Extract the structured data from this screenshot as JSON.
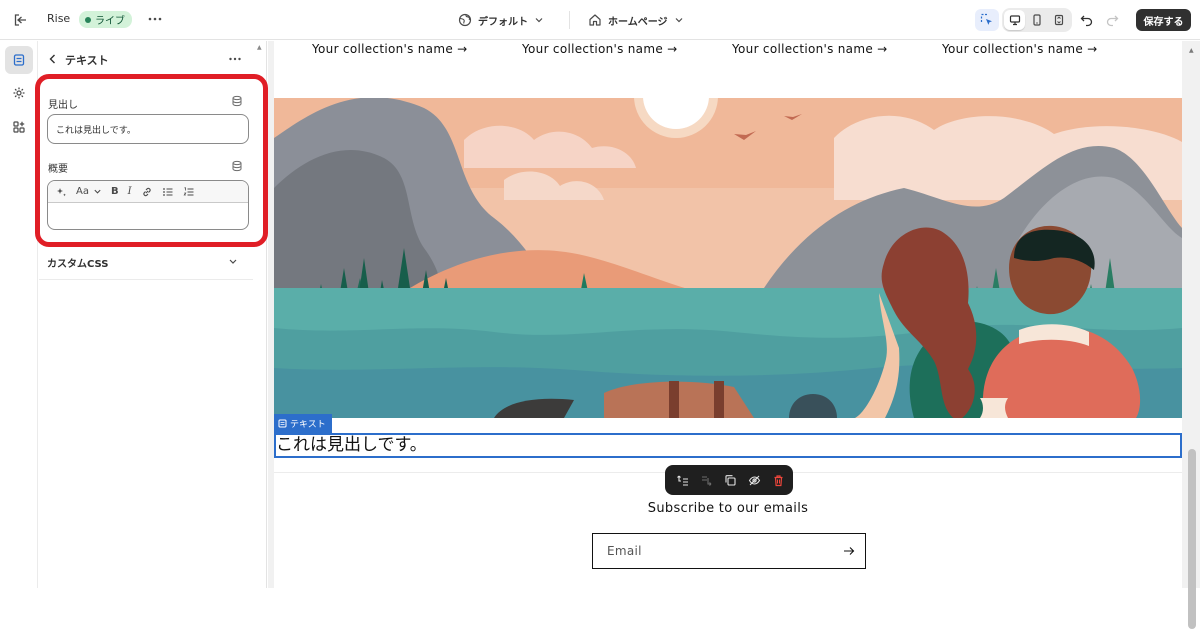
{
  "topbar": {
    "store_name": "Rise",
    "status_label": "ライブ",
    "theme_label": "デフォルト",
    "page_label": "ホームページ",
    "save_label": "保存する"
  },
  "sidebar": {
    "title": "テキスト",
    "heading_label": "見出し",
    "heading_value": "これは見出しです。",
    "summary_label": "概要",
    "custom_css_label": "カスタムCSS"
  },
  "preview": {
    "collections": [
      "Your collection's name →",
      "Your collection's name →",
      "Your collection's name →",
      "Your collection's name →"
    ],
    "block_tag": "テキスト",
    "heading_text": "これは見出しです。",
    "subscribe_title": "Subscribe to our emails",
    "email_placeholder": "Email"
  },
  "colors": {
    "highlight": "#e01e26",
    "selection": "#2c6ecb",
    "live_badge_bg": "#d3f2d9",
    "save_bg": "#303030"
  }
}
